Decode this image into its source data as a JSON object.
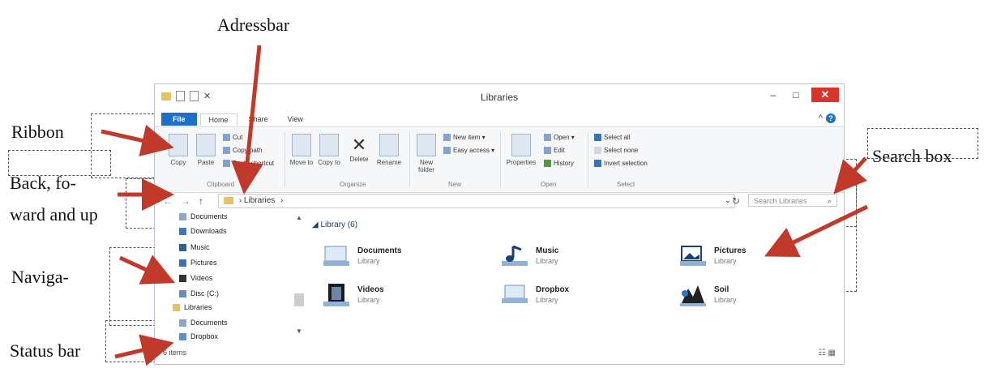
{
  "window": {
    "title": "Libraries",
    "qat_icons": [
      "folder-icon",
      "properties-icon",
      "new-folder-icon",
      "undo-icon"
    ],
    "min_label": "–",
    "max_label": "□",
    "close_label": "✕",
    "help_label": "?",
    "collapse_label": "^"
  },
  "tabs": [
    {
      "label": "File"
    },
    {
      "label": "Home"
    },
    {
      "label": "Share"
    },
    {
      "label": "View"
    }
  ],
  "ribbon": {
    "clipboard": {
      "copy": "Copy",
      "paste": "Paste",
      "cut": "Cut",
      "copy_path": "Copy path",
      "paste_shortcut": "Paste shortcut",
      "group": "Clipboard"
    },
    "organize": {
      "move_to": "Move to",
      "copy_to": "Copy to",
      "delete": "Delete",
      "rename": "Rename",
      "group": "Organize"
    },
    "new": {
      "new_folder": "New folder",
      "new_item": "New item ▾",
      "easy_access": "Easy access ▾",
      "group": "New"
    },
    "open": {
      "properties": "Properties",
      "open": "Open ▾",
      "edit": "Edit",
      "history": "History",
      "group": "Open"
    },
    "select": {
      "select_all": "Select all",
      "select_none": "Select none",
      "invert": "Invert selection",
      "group": "Select"
    }
  },
  "nav": {
    "back": "←",
    "forward": "→",
    "up": "↑",
    "address": "Libraries",
    "address_sep": "›",
    "refresh": "↻",
    "search_placeholder": "Search Libraries",
    "dropdown": "⌄"
  },
  "navpane": {
    "items": [
      {
        "label": "Documents",
        "color": "#8aa7c8"
      },
      {
        "label": "Downloads",
        "color": "#3b77c3"
      },
      {
        "label": "Music",
        "color": "#2a5fa8"
      },
      {
        "label": "Pictures",
        "color": "#3d6fb0"
      },
      {
        "label": "Videos",
        "color": "#333333"
      },
      {
        "label": "Disc (C:)",
        "color": "#6b8fb8"
      },
      {
        "label": "Libraries",
        "color": "#e7c261"
      },
      {
        "label": "Documents",
        "color": "#8aa7c8"
      },
      {
        "label": "Dropbox",
        "color": "#5a8fd0"
      }
    ]
  },
  "content": {
    "group_header": "Library (6)",
    "libraries": [
      {
        "name": "Documents",
        "sub": "Library"
      },
      {
        "name": "Music",
        "sub": "Library"
      },
      {
        "name": "Pictures",
        "sub": "Library"
      },
      {
        "name": "Videos",
        "sub": "Library"
      },
      {
        "name": "Dropbox",
        "sub": "Library"
      },
      {
        "name": "Soil",
        "sub": "Library"
      }
    ]
  },
  "status": {
    "text": "6 items",
    "views": "☷ ▦"
  },
  "callouts": {
    "addressbar": "Adressbar",
    "ribbon": "Ribbon",
    "search_box": "Search box",
    "back_line1": "Back, fo-",
    "back_line2": "ward and up",
    "navigation": "Naviga-",
    "status_bar": "Status bar"
  },
  "colors": {
    "accent": "#1d6fc7",
    "arrow": "#c0392b",
    "close": "#d9342b"
  }
}
